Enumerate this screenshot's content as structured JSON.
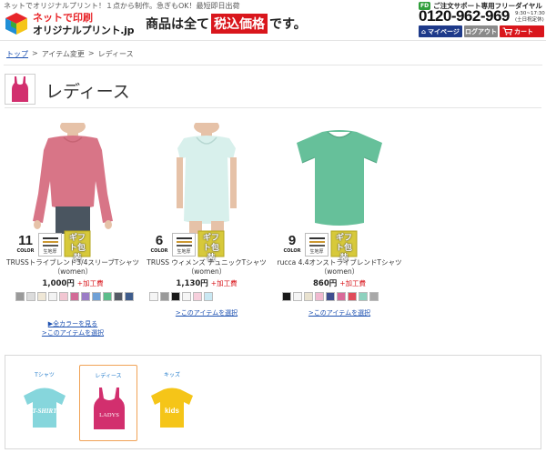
{
  "header": {
    "tagline": "ネットでオリジナルプリント！１点から制作。急ぎもOK！最短即日出荷",
    "logo_line1": "ネットで印刷",
    "logo_line2": "オリジナルプリント.jp",
    "slogan_pre": "商品は全て",
    "slogan_highlight": "税込価格",
    "slogan_post": "です。",
    "support_badge": "FD",
    "support_label": "ご注文サポート専用フリーダイヤル",
    "phone": "0120-962-969",
    "hours_line1": "9:30~17:30",
    "hours_line2": "(土日祝定休)",
    "mypage_label": "マイページ",
    "logout_label": "ログアウト",
    "cart_label": "カート"
  },
  "breadcrumb": {
    "home": "トップ",
    "sep": ">",
    "mid": "アイテム変更",
    "current": "レディース"
  },
  "page_title": "レディース",
  "products": [
    {
      "colors": "11",
      "color_label": "COLOR",
      "fabric_label": "生地厚",
      "gift_label": "ギフト包装",
      "name_line1": "TRUSSトライブレンド3/4スリーブTシャツ",
      "name_line2": "（women）",
      "price": "1,000円",
      "price_extra": "+加工費",
      "swatch_colors": [
        "#9a9a9a",
        "#dcdcdc",
        "#efe7d6",
        "#f3f3f3",
        "#f2c6d2",
        "#d26b97",
        "#9b7cc6",
        "#6fa0d6",
        "#5cbd8a",
        "#555a66",
        "#3e5c8c"
      ],
      "link_more_colors": "▶全カラーを見る",
      "link_select": ">このアイテムを選択"
    },
    {
      "colors": "6",
      "color_label": "COLOR",
      "fabric_label": "生地厚",
      "gift_label": "ギフト包装",
      "name_line1": "TRUSS ウィメンズ チュニックTシャツ",
      "name_line2": "（women）",
      "price": "1,130円",
      "price_extra": "+加工費",
      "swatch_colors": [
        "#f5f5f5",
        "#9a9a9a",
        "#1a1a1a",
        "#f6f6f6",
        "#f6cfdc",
        "#c9e8f3"
      ],
      "link_select": ">このアイテムを選択"
    },
    {
      "colors": "9",
      "color_label": "COLOR",
      "fabric_label": "生地厚",
      "gift_label": "ギフト包装",
      "name_line1": "rucca 4.4オンストライブレンドTシャツ",
      "name_line2": "（women）",
      "price": "860円",
      "price_extra": "+加工費",
      "swatch_colors": [
        "#1a1a1a",
        "#f5f5f5",
        "#e9e2cf",
        "#f1b9cf",
        "#3f4e8f",
        "#d96a99",
        "#e04b5a",
        "#8ed1be",
        "#a8a8a8"
      ],
      "link_select": ">このアイテムを選択"
    }
  ],
  "categories": [
    {
      "label": "Tシャツ",
      "shirt_text": "T-SHIRT",
      "color": "#86d6dc",
      "active": false
    },
    {
      "label": "レディース",
      "shirt_text": "LADYS",
      "color": "#d22f6e",
      "active": true
    },
    {
      "label": "キッズ",
      "shirt_text": "kids",
      "color": "#f5c518",
      "active": false
    }
  ],
  "colors": {
    "accent_red": "#d9161c",
    "nav_blue": "#1e3a8a",
    "link_blue": "#1b4fb0",
    "active_orange": "#f0a256"
  },
  "icons": {
    "mypage": "home-icon",
    "cart": "cart-icon",
    "gift": "gift-icon",
    "fabric": "fabric-thickness-icon"
  }
}
